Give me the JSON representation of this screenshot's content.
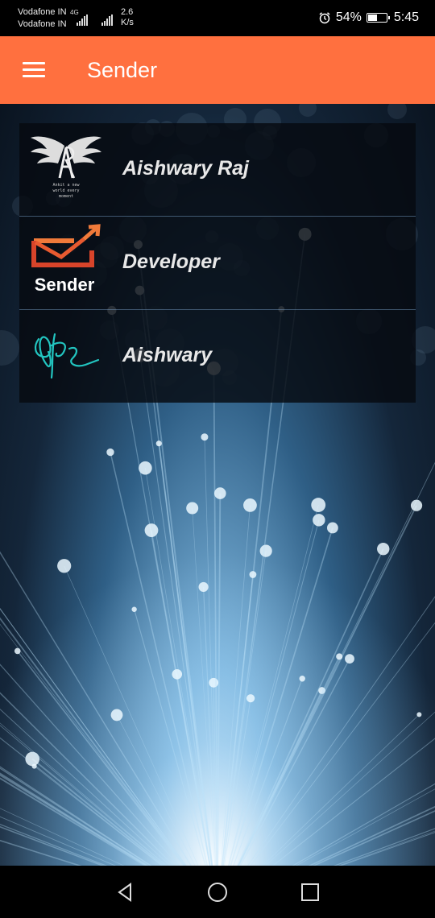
{
  "status_bar": {
    "carrier_1": "Vodafone IN",
    "carrier_2": "Vodafone IN",
    "network_type": "4G",
    "net_speed_value": "2.6",
    "net_speed_unit": "K/s",
    "battery": "54%",
    "battery_level": 0.54,
    "time": "5:45",
    "icons": [
      "signal-icon",
      "signal-icon",
      "alarm-icon",
      "battery-icon"
    ]
  },
  "app_bar": {
    "title": "Sender",
    "menu_icon": "hamburger-menu-icon"
  },
  "list": {
    "items": [
      {
        "label": "Aishwary Raj",
        "icon": "winged-monogram-logo",
        "logo_text": "Ankit a new world every moment"
      },
      {
        "label": "Developer",
        "icon": "sender-mail-logo",
        "logo_text": "Sender"
      },
      {
        "label": "Aishwary",
        "icon": "signature-logo"
      }
    ]
  },
  "colors": {
    "accent": "#ff703f",
    "mail_orange": "#f07a3a",
    "mail_red": "#d8442a",
    "signature_teal": "#22c5c0"
  },
  "nav_bar": {
    "icons": [
      "back-icon",
      "home-icon",
      "recents-icon"
    ]
  }
}
